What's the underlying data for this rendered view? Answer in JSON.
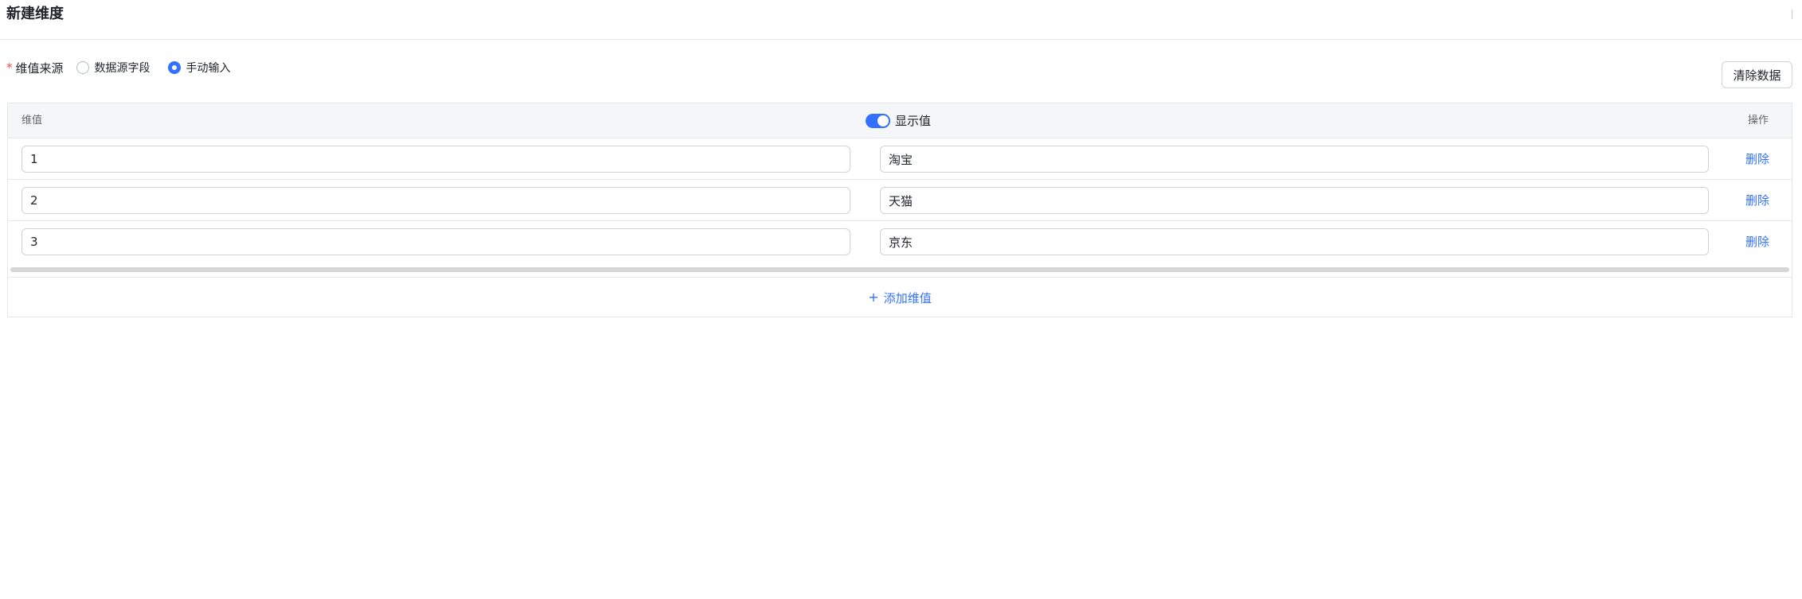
{
  "page": {
    "title": "新建维度"
  },
  "form": {
    "required_mark": "*",
    "label": "维值来源",
    "options": [
      {
        "label": "数据源字段",
        "checked": false
      },
      {
        "label": "手动输入",
        "checked": true
      }
    ]
  },
  "toolbar": {
    "clear_label": "清除数据"
  },
  "table": {
    "headers": {
      "value": "维值",
      "display": "显示值",
      "operation": "操作"
    },
    "display_toggle_on": true,
    "rows": [
      {
        "value": "1",
        "display": "淘宝",
        "delete_label": "删除"
      },
      {
        "value": "2",
        "display": "天猫",
        "delete_label": "删除"
      },
      {
        "value": "3",
        "display": "京东",
        "delete_label": "删除"
      }
    ],
    "add_label": "添加维值",
    "add_icon": "+"
  },
  "colors": {
    "accent": "#3370ff",
    "required": "#f54a45",
    "header_bg": "#f5f6f7",
    "border": "#e5e6eb"
  }
}
